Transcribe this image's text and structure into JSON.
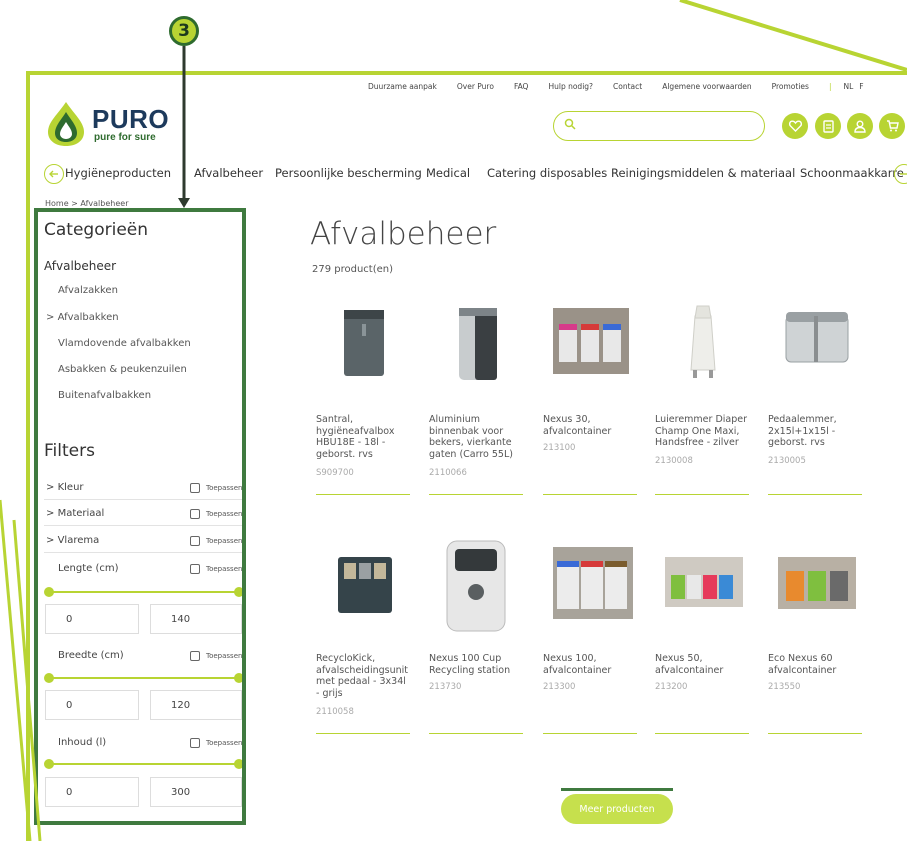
{
  "annotation": {
    "step_number": "3"
  },
  "utility_nav": [
    "Duurzame aanpak",
    "Over Puro",
    "FAQ",
    "Hulp nodig?",
    "Contact",
    "Algemene voorwaarden",
    "Promoties"
  ],
  "language": "NL",
  "language_cut": "F",
  "logo": {
    "name": "PURO",
    "tagline": "pure for sure"
  },
  "search": {
    "placeholder": "",
    "value": ""
  },
  "header_icons": [
    "heart-icon",
    "document-icon",
    "user-icon",
    "cart-icon"
  ],
  "category_nav": [
    "Hygiëneproducten",
    "Afvalbeheer",
    "Persoonlijke bescherming",
    "Medical",
    "Catering disposables",
    "Reinigingsmiddelen & materiaal",
    "Schoonmaakkarre"
  ],
  "breadcrumb": "Home > Afvalbeheer",
  "sidebar": {
    "title": "Categorieën",
    "main": "Afvalbeheer",
    "items": [
      "Afvalzakken",
      "Afvalbakken",
      "Vlamdovende afvalbakken",
      "Asbakken & peukenzuilen",
      "Buitenafvalbakken"
    ],
    "expanded_prefix": ">",
    "filters_title": "Filters",
    "filters": [
      {
        "label": "Kleur",
        "prefix": ">",
        "apply": "Toepassen"
      },
      {
        "label": "Materiaal",
        "prefix": ">",
        "apply": "Toepassen"
      },
      {
        "label": "Vlarema",
        "prefix": ">",
        "apply": "Toepassen"
      },
      {
        "label": "Lengte (cm)",
        "prefix": "",
        "apply": "Toepassen"
      },
      {
        "label": "Breedte (cm)",
        "prefix": "",
        "apply": "Toepassen"
      },
      {
        "label": "Inhoud (l)",
        "prefix": "",
        "apply": "Toepassen"
      }
    ],
    "ranges": [
      {
        "min": "0",
        "max": "140"
      },
      {
        "min": "0",
        "max": "120"
      },
      {
        "min": "0",
        "max": "300"
      }
    ]
  },
  "main": {
    "title": "Afvalbeheer",
    "count": "279 product(en)",
    "products": [
      {
        "name": "Santral, hygiëneafvalbox HBU18E - 18l - geborst. rvs",
        "code": "S909700"
      },
      {
        "name": "Aluminium binnenbak voor bekers, vierkante gaten (Carro 55L)",
        "code": "2110066"
      },
      {
        "name": "Nexus 30, afvalcontainer",
        "code": "213100"
      },
      {
        "name": "Luieremmer Diaper Champ One Maxi, Handsfree - zilver",
        "code": "2130008"
      },
      {
        "name": "Pedaalemmer, 2x15l+1x15l - geborst. rvs",
        "code": "2130005"
      },
      {
        "name": "RecycloKick, afvalscheidingsunit met pedaal - 3x34l - grijs",
        "code": "2110058"
      },
      {
        "name": "Nexus 100 Cup Recycling station",
        "code": "213730"
      },
      {
        "name": "Nexus 100, afvalcontainer",
        "code": "213300"
      },
      {
        "name": "Nexus 50, afvalcontainer",
        "code": "213200"
      },
      {
        "name": "Eco Nexus 60 afvalcontainer",
        "code": "213550"
      }
    ],
    "more_button": "Meer producten"
  },
  "colors": {
    "accent": "#b8d433",
    "dark_green": "#3f7a3f",
    "navy": "#1d3a5c"
  }
}
